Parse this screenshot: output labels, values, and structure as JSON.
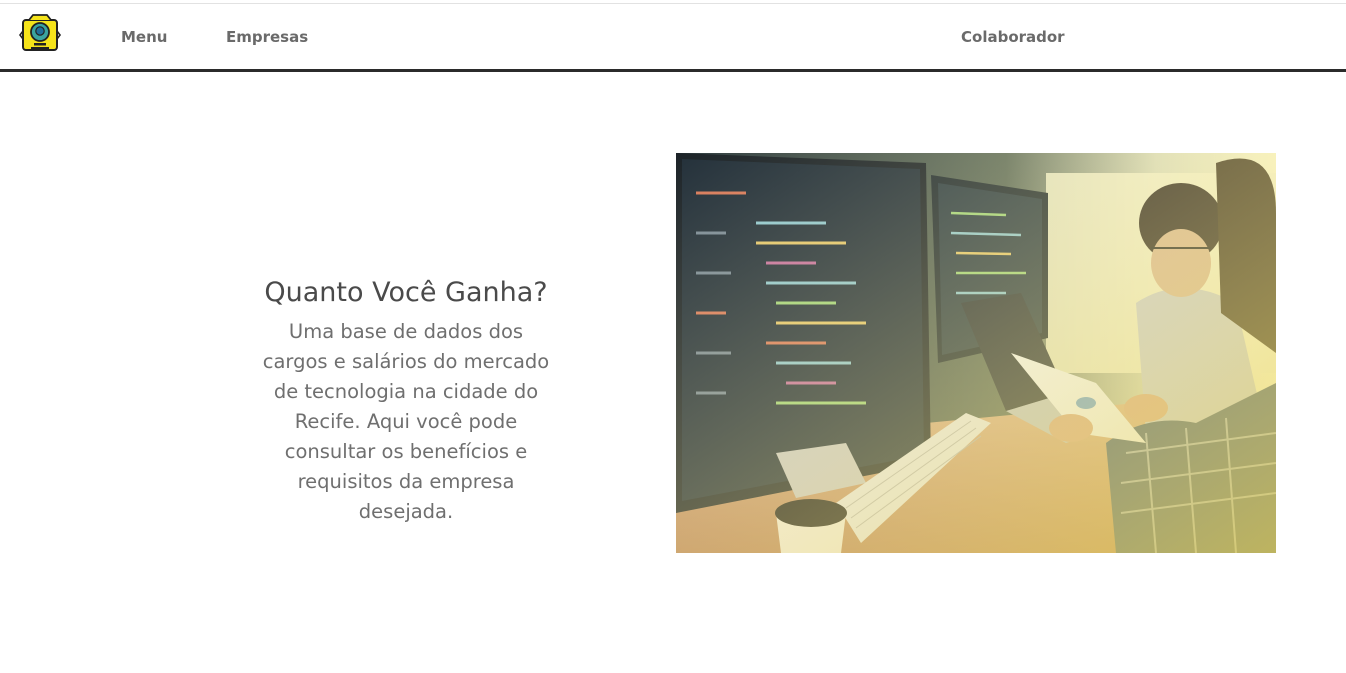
{
  "nav": {
    "logo_icon": "helmet-figure-logo",
    "items": [
      "Menu",
      "Empresas"
    ],
    "user_link": "Colaborador"
  },
  "hero": {
    "title": "Quanto Você Ganha?",
    "description": "Uma base de dados dos cargos e salários do mercado de tecnologia na cidade do Recife. Aqui você pode consultar os benefícios e requisitos da empresa desejada.",
    "image_subject": "developers-working-at-computers-photo"
  },
  "colors": {
    "nav_text": "#6a6a6a",
    "nav_border": "#2b2b2b",
    "title": "#4a4a4a",
    "body_text": "#6f6f6f",
    "logo_yellow": "#f5e31a"
  }
}
